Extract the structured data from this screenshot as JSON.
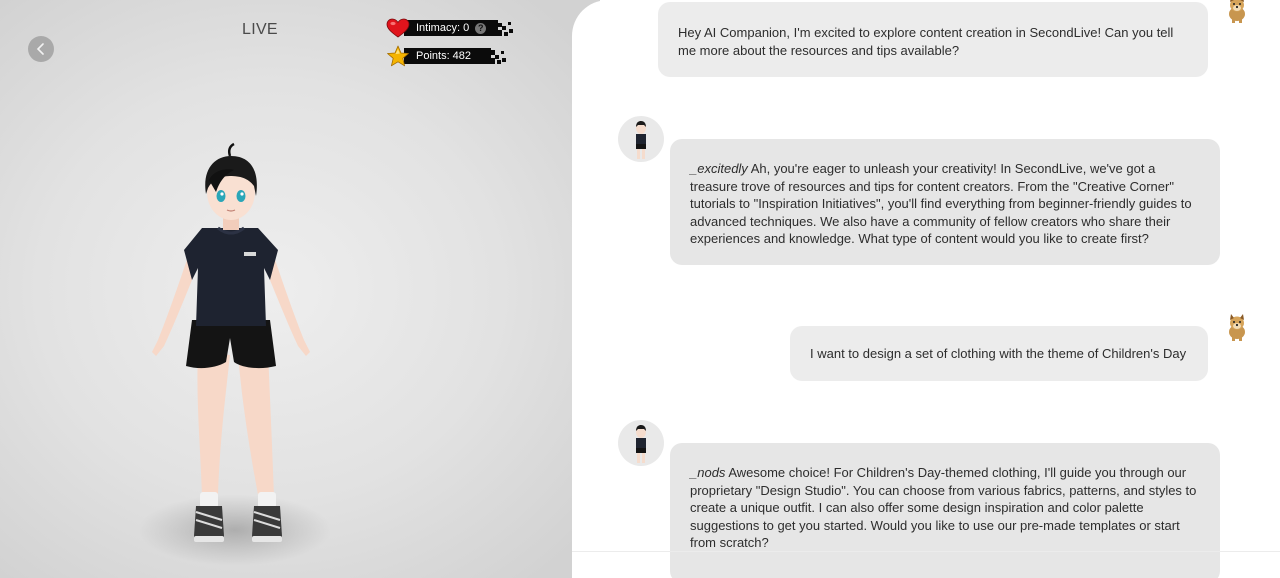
{
  "stage": {
    "live_label": "LIVE",
    "intimacy_label": "Intimacy: 0",
    "points_label": "Points: 482",
    "help_glyph": "?",
    "icons": {
      "back": "chevron-left-icon",
      "intimacy": "heart-icon",
      "points": "star-icon",
      "help": "question-icon"
    },
    "colors": {
      "heart": "#e0141c",
      "star": "#f5b400",
      "stat_bar": "#0b0b0b"
    }
  },
  "chat": {
    "messages": [
      {
        "role": "user",
        "text": "Hey AI Companion, I'm excited to explore content creation in SecondLive! Can you tell me more about the resources and tips available?"
      },
      {
        "role": "assistant",
        "emote": "_excitedly",
        "text": " Ah, you're eager to unleash your creativity! In SecondLive, we've got a treasure trove of resources and tips for content creators. From the \"Creative Corner\" tutorials to \"Inspiration Initiatives\", you'll find everything from beginner-friendly guides to advanced techniques. We also have a community of fellow creators who share their experiences and knowledge. What type of content would you like to create first?"
      },
      {
        "role": "user",
        "text": "I want to design a set of clothing with the theme of Children's Day"
      },
      {
        "role": "assistant",
        "emote": "_nods",
        "text": " Awesome choice! For Children's Day-themed clothing, I'll guide you through our proprietary \"Design Studio\". You can choose from various fabrics, patterns, and styles to create a unique outfit. I can also offer some design inspiration and color palette suggestions to get you started. Would you like to use our pre-made templates or start from scratch?"
      }
    ]
  }
}
